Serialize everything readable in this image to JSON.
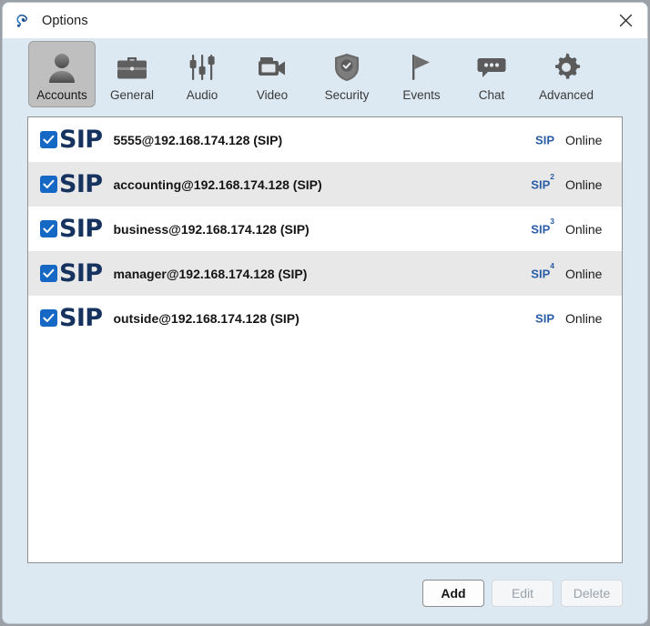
{
  "window": {
    "title": "Options",
    "app_icon": "phone-app-icon",
    "close_label": "✕",
    "bg_color": "#dde9f2",
    "titlebar_color": "#ffffff"
  },
  "toolbar": {
    "selected": "Accounts",
    "tabs": [
      {
        "label": "Accounts",
        "icon": "person-icon",
        "selected": true
      },
      {
        "label": "General",
        "icon": "briefcase-icon",
        "selected": false
      },
      {
        "label": "Audio",
        "icon": "sliders-icon",
        "selected": false
      },
      {
        "label": "Video",
        "icon": "camcorder-icon",
        "selected": false
      },
      {
        "label": "Security",
        "icon": "shield-check-icon",
        "selected": false
      },
      {
        "label": "Events",
        "icon": "flag-icon",
        "selected": false
      },
      {
        "label": "Chat",
        "icon": "chat-bubble-icon",
        "selected": false
      },
      {
        "label": "Advanced",
        "icon": "gear-icon",
        "selected": false
      }
    ]
  },
  "accounts": {
    "logo_text": "SIP",
    "rows": [
      {
        "checked": true,
        "name": "5555@192.168.174.128 (SIP)",
        "protocol": "SIP",
        "instance": "",
        "status": "Online"
      },
      {
        "checked": true,
        "name": "accounting@192.168.174.128 (SIP)",
        "protocol": "SIP",
        "instance": "2",
        "status": "Online"
      },
      {
        "checked": true,
        "name": "business@192.168.174.128 (SIP)",
        "protocol": "SIP",
        "instance": "3",
        "status": "Online"
      },
      {
        "checked": true,
        "name": "manager@192.168.174.128 (SIP)",
        "protocol": "SIP",
        "instance": "4",
        "status": "Online"
      },
      {
        "checked": true,
        "name": "outside@192.168.174.128 (SIP)",
        "protocol": "SIP",
        "instance": "",
        "status": "Online"
      }
    ]
  },
  "footer": {
    "add_label": "Add",
    "edit_label": "Edit",
    "delete_label": "Delete",
    "add_enabled": true,
    "edit_enabled": false,
    "delete_enabled": false
  },
  "colors": {
    "accent_checkbox": "#1668c5",
    "sip_logo": "#16335f",
    "protocol_text": "#2a5da8",
    "row_alt": "#e8e8e8"
  }
}
